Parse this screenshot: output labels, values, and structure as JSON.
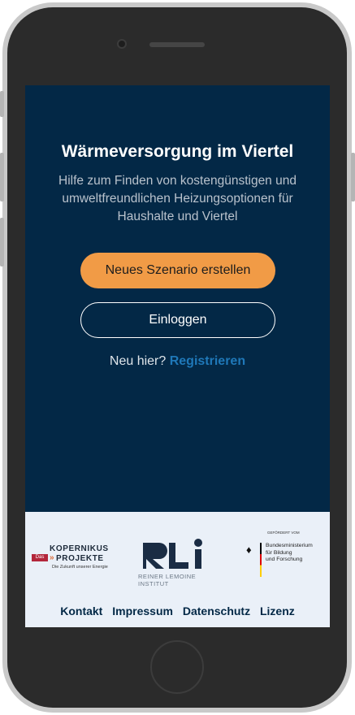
{
  "hero": {
    "title": "Wärmeversorgung im Viertel",
    "subtitle": "Hilfe zum Finden von kostengünstigen und umweltfreundlichen Heizungsoptionen für Haushalte und Viertel",
    "primary_button": "Neues Szenario erstellen",
    "secondary_button": "Einloggen",
    "register_prompt": "Neu hier?",
    "register_link": "Registrieren"
  },
  "logos": {
    "kopernikus": {
      "badge": "Das",
      "line1": "KOPERNIKUS",
      "line2": "PROJEKTE",
      "tagline": "Die Zukunft unserer Energie"
    },
    "rli": {
      "mark": "RLI",
      "line1": "REINER LEMOINE",
      "line2": "INSTITUT"
    },
    "bmbf": {
      "sponsor": "GEFÖRDERT VOM",
      "line1": "Bundesministerium",
      "line2": "für Bildung",
      "line3": "und Forschung"
    }
  },
  "footer": {
    "links": [
      "Kontakt",
      "Impressum",
      "Datenschutz",
      "Lizenz"
    ]
  },
  "colors": {
    "screen_bg": "#032846",
    "accent": "#f19b46",
    "link": "#1f78b8",
    "footer_bg": "#eaf0f8"
  }
}
